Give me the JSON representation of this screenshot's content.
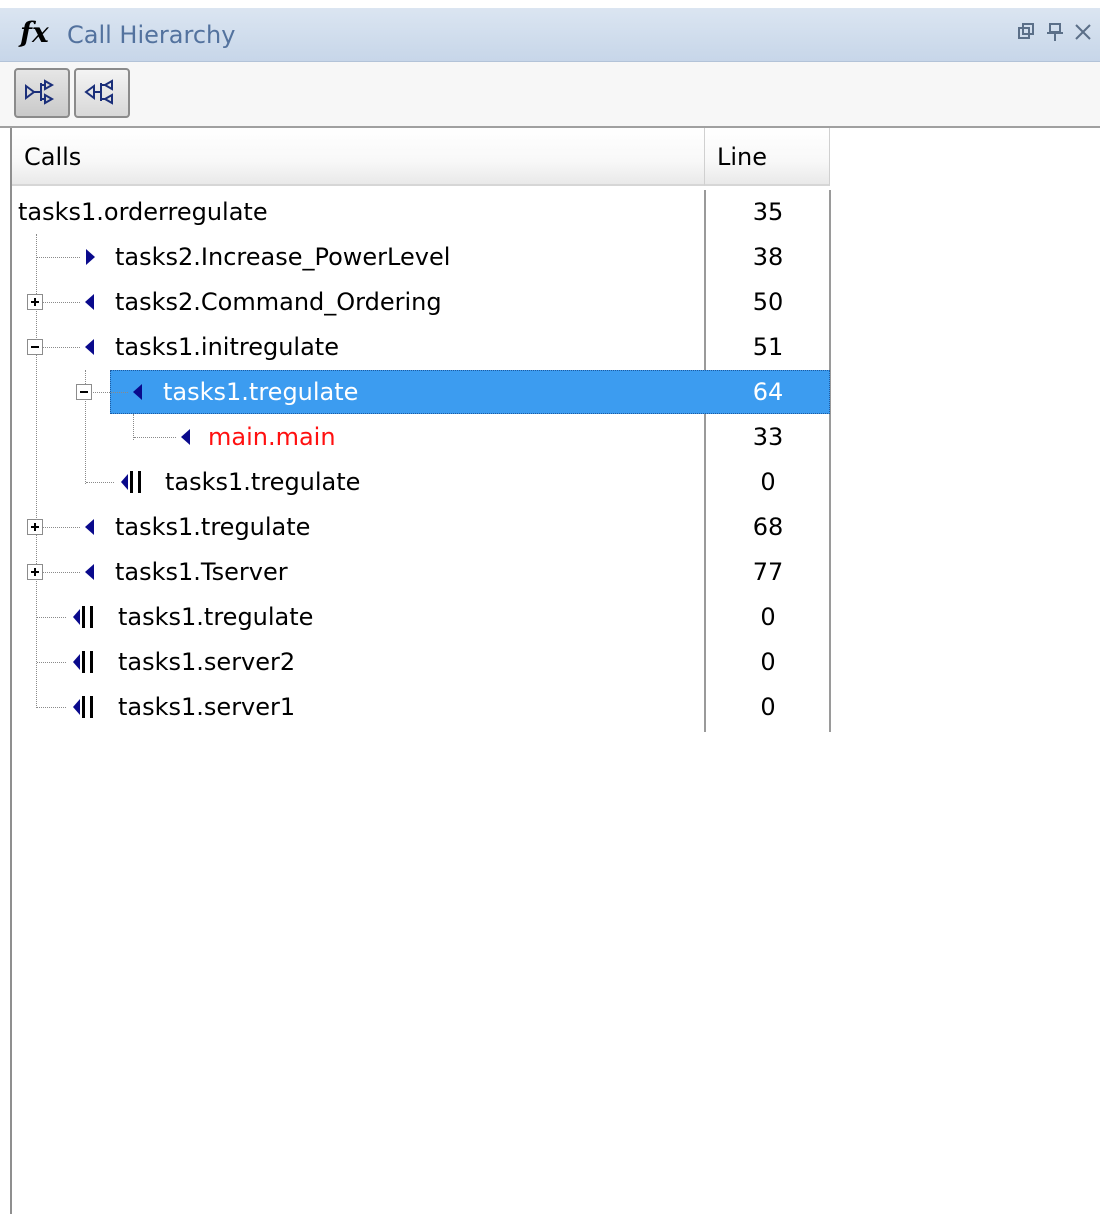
{
  "window": {
    "title": "Call Hierarchy",
    "icon": "fx-icon",
    "buttons": [
      "restore-icon",
      "pin-icon",
      "close-icon"
    ]
  },
  "toolbar": {
    "buttons": [
      {
        "name": "show-callees",
        "icon": "callees-icon",
        "pressed": true
      },
      {
        "name": "show-callers",
        "icon": "callers-icon",
        "pressed": false
      }
    ]
  },
  "table": {
    "columns": [
      "Calls",
      "Line"
    ],
    "rows": [
      {
        "label": "tasks1.orderregulate",
        "line": "35",
        "level": 0,
        "icon": "none",
        "expander": "none"
      },
      {
        "label": "tasks2.Increase_PowerLevel",
        "line": "38",
        "level": 1,
        "icon": "callee-arrow-right",
        "expander": "none"
      },
      {
        "label": "tasks2.Command_Ordering",
        "line": "50",
        "level": 1,
        "icon": "caller-arrow-left",
        "expander": "plus"
      },
      {
        "label": "tasks1.initregulate",
        "line": "51",
        "level": 1,
        "icon": "caller-arrow-left",
        "expander": "minus"
      },
      {
        "label": "tasks1.tregulate",
        "line": "64",
        "level": 2,
        "icon": "caller-arrow-left",
        "expander": "minus",
        "selected": true
      },
      {
        "label": "main.main",
        "line": "33",
        "level": 3,
        "icon": "caller-arrow-left",
        "expander": "none",
        "color": "#ff1010"
      },
      {
        "label": "tasks1.tregulate",
        "line": "0",
        "level": 2,
        "icon": "task-entry-icon",
        "expander": "none"
      },
      {
        "label": "tasks1.tregulate",
        "line": "68",
        "level": 1,
        "icon": "caller-arrow-left",
        "expander": "plus"
      },
      {
        "label": "tasks1.Tserver",
        "line": "77",
        "level": 1,
        "icon": "caller-arrow-left",
        "expander": "plus"
      },
      {
        "label": "tasks1.tregulate",
        "line": "0",
        "level": 1,
        "icon": "task-entry-icon",
        "expander": "none"
      },
      {
        "label": "tasks1.server2",
        "line": "0",
        "level": 1,
        "icon": "task-entry-icon",
        "expander": "none"
      },
      {
        "label": "tasks1.server1",
        "line": "0",
        "level": 1,
        "icon": "task-entry-icon",
        "expander": "none"
      }
    ]
  },
  "colors": {
    "title_bar": "#c7d6e9",
    "title_text": "#53729e",
    "selection": "#3c9cf0",
    "arrow": "#0a0a8c",
    "highlight_text": "#ff1010"
  }
}
